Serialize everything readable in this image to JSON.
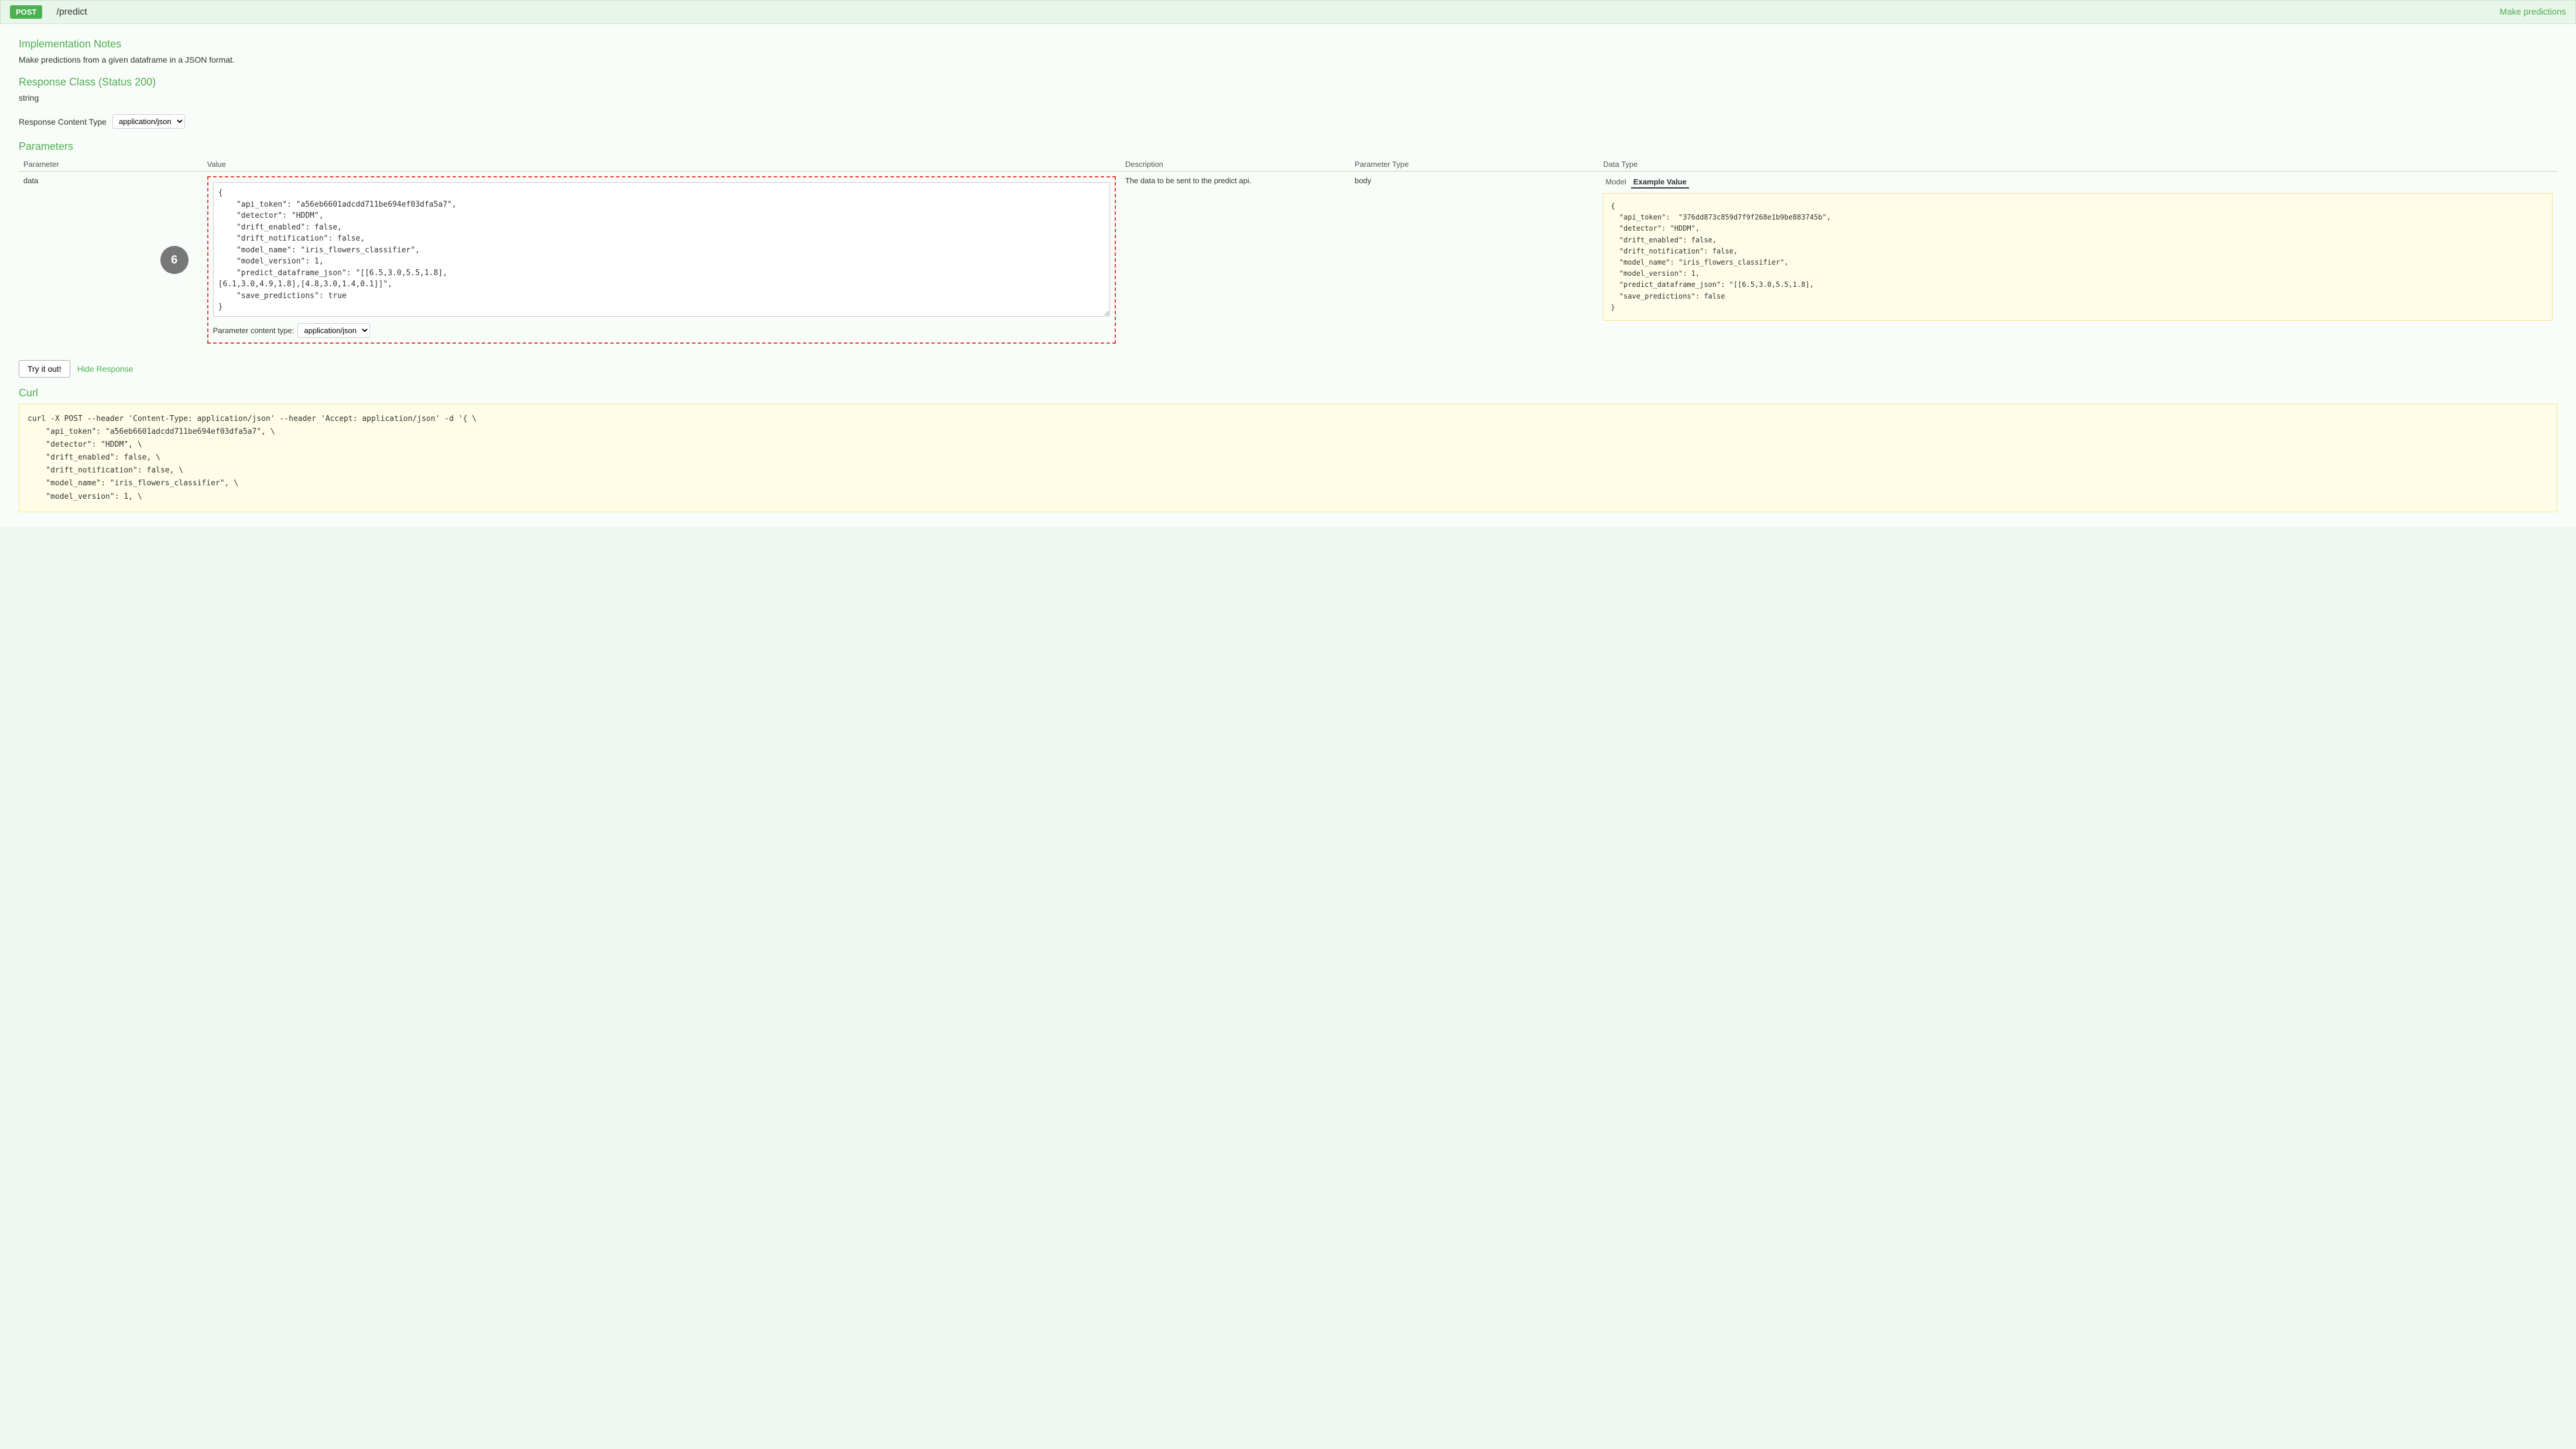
{
  "header": {
    "method_badge": "POST",
    "endpoint_path": "/predict",
    "make_predictions_label": "Make predictions"
  },
  "implementation_notes": {
    "title": "Implementation Notes",
    "description": "Make predictions from a given dataframe in a JSON format."
  },
  "response_class": {
    "title": "Response Class (Status 200)",
    "value": "string"
  },
  "response_content_type": {
    "label": "Response Content Type",
    "selected": "application/json",
    "options": [
      "application/json"
    ]
  },
  "parameters": {
    "title": "Parameters",
    "columns": {
      "parameter": "Parameter",
      "value": "Value",
      "description": "Description",
      "parameter_type": "Parameter Type",
      "data_type": "Data Type"
    },
    "rows": [
      {
        "name": "data",
        "textarea_value": "{\n    \"api_token\": \"a56eb6601adcdd711be694ef03dfa5a7\",\n    \"detector\": \"HDDM\",\n    \"drift_enabled\": false,\n    \"drift_notification\": false,\n    \"model_name\": \"iris_flowers_classifier\",\n    \"model_version\": 1,\n    \"predict_dataframe_json\": \"[[6.5,3.0,5.5,1.8],\n[6.1,3.0,4.9,1.8],[4.8,3.0,1.4,0.1]]\",\n    \"save_predictions\": true\n}",
        "description": "The data to be sent to the predict api.",
        "param_type": "body",
        "param_content_type": "application/json"
      }
    ],
    "circle_number": "6"
  },
  "model_tabs": {
    "model_label": "Model",
    "example_value_label": "Example Value"
  },
  "example_value": {
    "lines": [
      "{",
      "    \"api_token\":  \"376dd873c859d7f9f268e1b9be883745b\",",
      "    \"detector\": \"HDDM\",",
      "    \"drift_enabled\": false,",
      "    \"drift_notification\": false,",
      "    \"model_name\": \"iris_flowers_classifier\",",
      "    \"model_version\": 1,",
      "    \"predict_dataframe_json\": \"[[6.5,3.0,5.5,1.8],",
      "    \"save_predictions\": false",
      "}"
    ]
  },
  "actions": {
    "try_it_out_label": "Try it out!",
    "hide_response_label": "Hide Response"
  },
  "curl": {
    "title": "Curl",
    "lines": [
      "curl -X POST --header 'Content-Type: application/json' --header 'Accept: application/json' -d '{  \\",
      "    \"api_token\": \"a56eb6601adcdd711be694ef03dfa5a7\",  \\",
      "    \"detector\": \"HDDM\",  \\",
      "    \"drift_enabled\": false,  \\",
      "    \"drift_notification\": false,  \\",
      "    \"model_name\": \"iris_flowers_classifier\",  \\",
      "    \"model_version\": 1,  \\"
    ]
  }
}
